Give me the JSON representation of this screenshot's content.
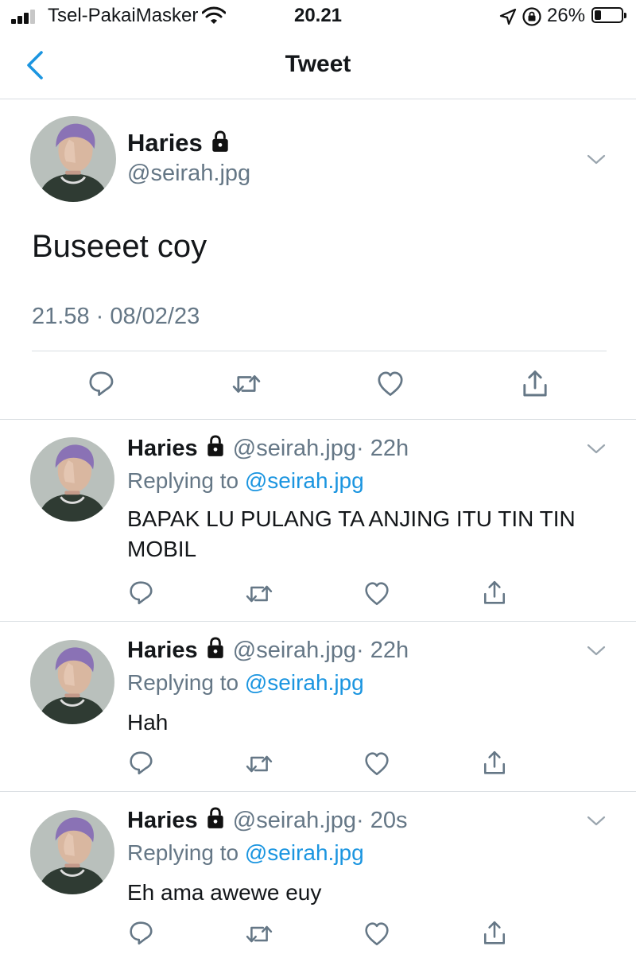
{
  "status_bar": {
    "carrier": "Tsel-PakaiMasker",
    "time": "20.21",
    "battery_percent": "26%"
  },
  "nav": {
    "title": "Tweet"
  },
  "main_tweet": {
    "name": "Haries",
    "handle": "@seirah.jpg",
    "text": "Buseeet coy",
    "timestamp": "21.58 · 08/02/23"
  },
  "replies": [
    {
      "name": "Haries",
      "handle": "@seirah.jpg",
      "age": "· 22h",
      "replying_prefix": "Replying to ",
      "replying_to": "@seirah.jpg",
      "text": "BAPAK LU PULANG TA ANJING ITU TIN TIN MOBIL"
    },
    {
      "name": "Haries",
      "handle": "@seirah.jpg",
      "age": "· 22h",
      "replying_prefix": "Replying to ",
      "replying_to": "@seirah.jpg",
      "text": "Hah"
    },
    {
      "name": "Haries",
      "handle": "@seirah.jpg",
      "age": "· 20s",
      "replying_prefix": "Replying to ",
      "replying_to": "@seirah.jpg",
      "text": "Eh ama awewe euy"
    }
  ],
  "icons": {
    "back": "chevron-left-icon",
    "lock": "lock-icon",
    "more": "chevron-down-icon",
    "reply": "reply-icon",
    "retweet": "retweet-icon",
    "like": "heart-icon",
    "share": "share-icon"
  },
  "colors": {
    "accent": "#1b95e0",
    "secondary_text": "#657786",
    "divider": "#d8dde1"
  }
}
